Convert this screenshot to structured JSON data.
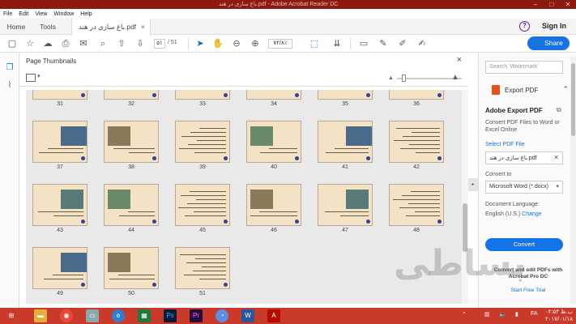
{
  "window": {
    "title": "باغ سازی در هند.pdf - Adobe Acrobat Reader DC"
  },
  "menu": [
    "File",
    "Edit",
    "View",
    "Window",
    "Help"
  ],
  "tabs": {
    "home": "Home",
    "tools": "Tools",
    "document": "باغ سازی در هند.pdf",
    "close": "×"
  },
  "header": {
    "help": "?",
    "signin": "Sign In"
  },
  "toolbar": {
    "page_current": "۵۱",
    "page_total": "/ 51",
    "zoom": "۷۲/۸٪",
    "share_label": "Share"
  },
  "thumbnails": {
    "title": "Page Thumbnails",
    "close": "×",
    "pages": [
      "31",
      "32",
      "33",
      "34",
      "35",
      "36",
      "37",
      "38",
      "39",
      "40",
      "41",
      "42",
      "43",
      "44",
      "45",
      "46",
      "47",
      "48",
      "49",
      "50",
      "51"
    ]
  },
  "right_panel": {
    "search_placeholder": "Search 'Watermark'",
    "export_title": "Export PDF",
    "section_title": "Adobe Export PDF",
    "description": "Convert PDF Files to Word or Excel Online",
    "select_link": "Select PDF File",
    "file_name": "باغ سازی در هند.pdf",
    "convert_to_label": "Convert to",
    "convert_format": "Microsoft Word (*.docx)",
    "language_label": "Document Language:",
    "language_value": "English (U.S.)",
    "language_change": "Change",
    "convert_button": "Convert",
    "promo": "Convert and edit PDFs with Acrobat Pro DC",
    "trial": "Start Free Trial"
  },
  "watermark": "بساطی",
  "taskbar": {
    "lang": "FA",
    "time": "۰۲:۵۴ ب.ظ",
    "date": "۲۰۱۷/۰۱/۱۸"
  },
  "colors": {
    "titlebar": "#8c1a10",
    "accent": "#1473e6",
    "taskbar": "#c93a2b",
    "thumb_bg": "#f4e2c4"
  }
}
